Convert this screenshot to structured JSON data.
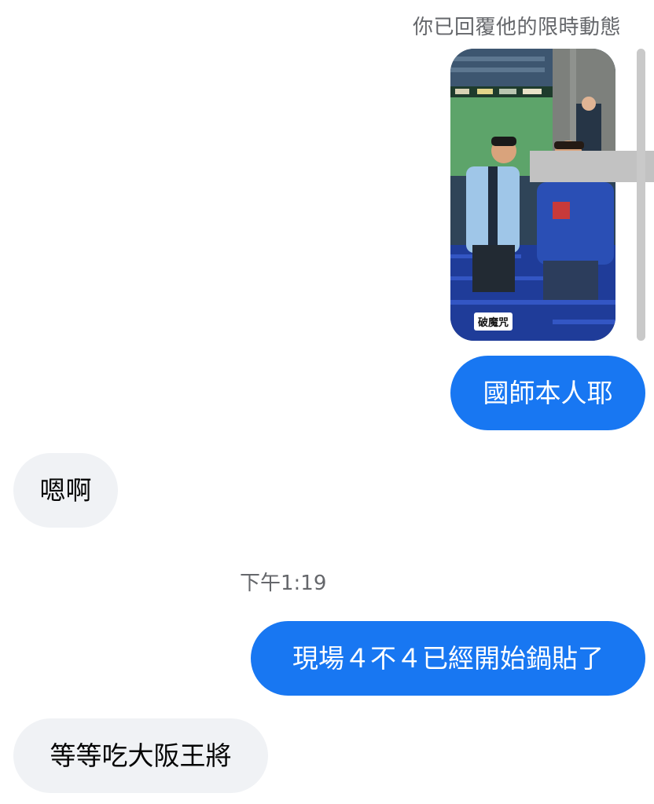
{
  "reply_label": "你已回覆他的限時動態",
  "story": {
    "sticker_text": "破魔咒"
  },
  "timestamp": "下午1:19",
  "messages": [
    {
      "text": "國師本人耶",
      "direction": "outgoing"
    },
    {
      "text": "嗯啊",
      "direction": "incoming"
    },
    {
      "text": "現場４不４已經開始鍋貼了",
      "direction": "outgoing"
    },
    {
      "text": "等等吃大阪王將",
      "direction": "incoming"
    }
  ],
  "colors": {
    "outgoing_bubble": "#1877f2",
    "incoming_bubble": "#f0f2f5",
    "meta_text": "#65676b"
  }
}
